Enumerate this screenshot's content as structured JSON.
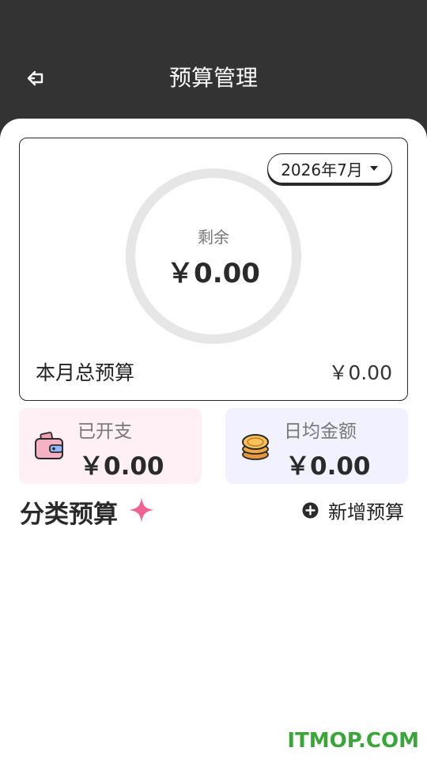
{
  "header": {
    "title": "预算管理",
    "back_icon": "arrow-left-icon"
  },
  "summary": {
    "month": "2026年7月",
    "remaining_label": "剩余",
    "remaining_value": "￥0.00",
    "total_label": "本月总预算",
    "total_value": "￥0.00",
    "progress": 0
  },
  "stats": {
    "spent": {
      "label": "已开支",
      "value": "￥0.00",
      "icon": "wallet-icon"
    },
    "daily": {
      "label": "日均金额",
      "value": "￥0.00",
      "icon": "coins-icon"
    }
  },
  "category": {
    "title": "分类预算",
    "add_label": "新增预算",
    "sparkle_icon": "sparkle-icon",
    "add_icon": "plus-circle-icon"
  },
  "watermark": "ITMOP.COM",
  "colors": {
    "header_bg": "#333333",
    "ring_track": "#e6e6e6",
    "spent_bg": "#fff0f6",
    "daily_bg": "#f1f1ff",
    "sparkle": "#f06292",
    "watermark": "#3aa639"
  }
}
